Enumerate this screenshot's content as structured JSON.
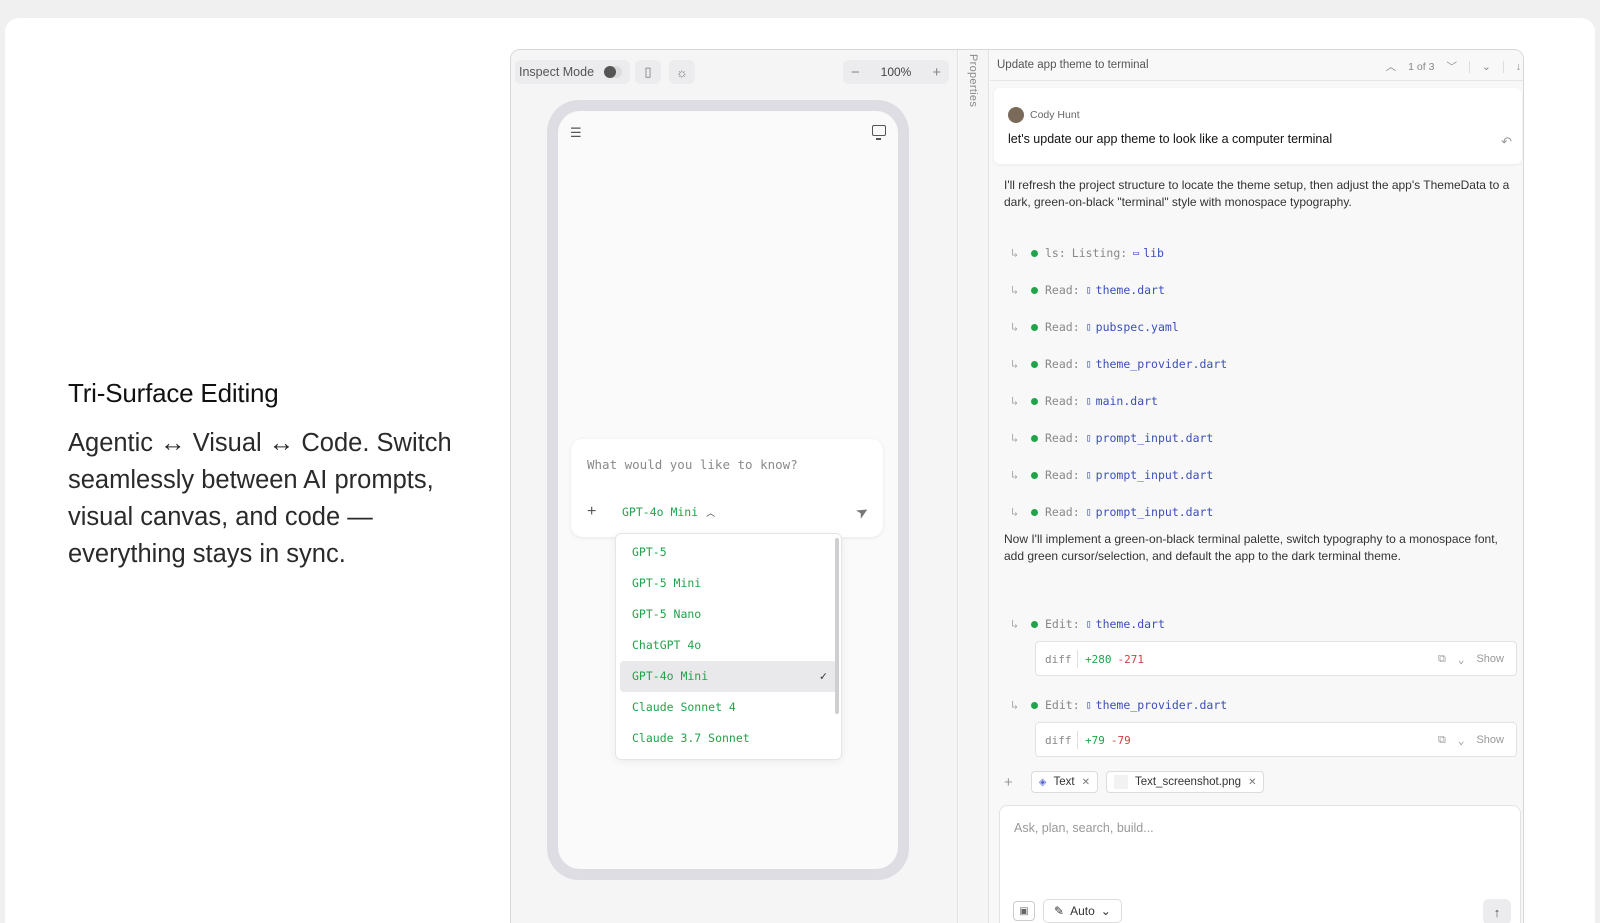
{
  "hero": {
    "title": "Tri-Surface Editing",
    "body": "Agentic ↔ Visual ↔ Code. Switch seamlessly between AI prompts, visual canvas, and code — everything stays in sync."
  },
  "toolbar": {
    "inspect_label": "Inspect Mode",
    "zoom_value": "100%",
    "zoom_minus": "−",
    "zoom_plus": "+"
  },
  "phone": {
    "prompt_placeholder": "What would you like to know?",
    "selected_model": "GPT-4o Mini",
    "models": [
      "GPT-5",
      "GPT-5 Mini",
      "GPT-5 Nano",
      "ChatGPT 4o",
      "GPT-4o Mini",
      "Claude Sonnet 4",
      "Claude 3.7 Sonnet"
    ]
  },
  "properties_label": "Properties",
  "chat": {
    "title": "Update app theme to terminal",
    "pager": "1 of 3",
    "user": {
      "name": "Cody Hunt",
      "message": "let's update our app theme to look like a computer terminal"
    },
    "intro": "I'll refresh the project structure to locate the theme setup, then adjust the app's ThemeData to a dark, green-on-black \"terminal\" style with monospace typography.",
    "steps": [
      {
        "label": "ls:",
        "prefix": "Listing:",
        "file": "lib",
        "icon": "folder"
      },
      {
        "label": "Read:",
        "file": "theme.dart",
        "icon": "file"
      },
      {
        "label": "Read:",
        "file": "pubspec.yaml",
        "icon": "file"
      },
      {
        "label": "Read:",
        "file": "theme_provider.dart",
        "icon": "file"
      },
      {
        "label": "Read:",
        "file": "main.dart",
        "icon": "file"
      },
      {
        "label": "Read:",
        "file": "prompt_input.dart",
        "icon": "file"
      },
      {
        "label": "Read:",
        "file": "prompt_input.dart",
        "icon": "file"
      },
      {
        "label": "Read:",
        "file": "prompt_input.dart",
        "icon": "file"
      }
    ],
    "second": "Now I'll implement a green-on-black terminal palette, switch typography to a monospace font, add green cursor/selection, and default the app to the dark terminal theme.",
    "edits": [
      {
        "label": "Edit:",
        "file": "theme.dart",
        "diff_label": "diff",
        "added": "+280",
        "removed": "-271",
        "show": "Show"
      },
      {
        "label": "Edit:",
        "file": "theme_provider.dart",
        "diff_label": "diff",
        "added": "+79",
        "removed": "-79",
        "show": "Show"
      }
    ],
    "chips": [
      {
        "label": "Text"
      },
      {
        "label": "Text_screenshot.png"
      }
    ],
    "composer_placeholder": "Ask, plan, search, build...",
    "mode": "Auto"
  },
  "colors": {
    "accent_green": "#22a34a",
    "file_link": "#3b4fb8",
    "diff_removed": "#d04040"
  }
}
